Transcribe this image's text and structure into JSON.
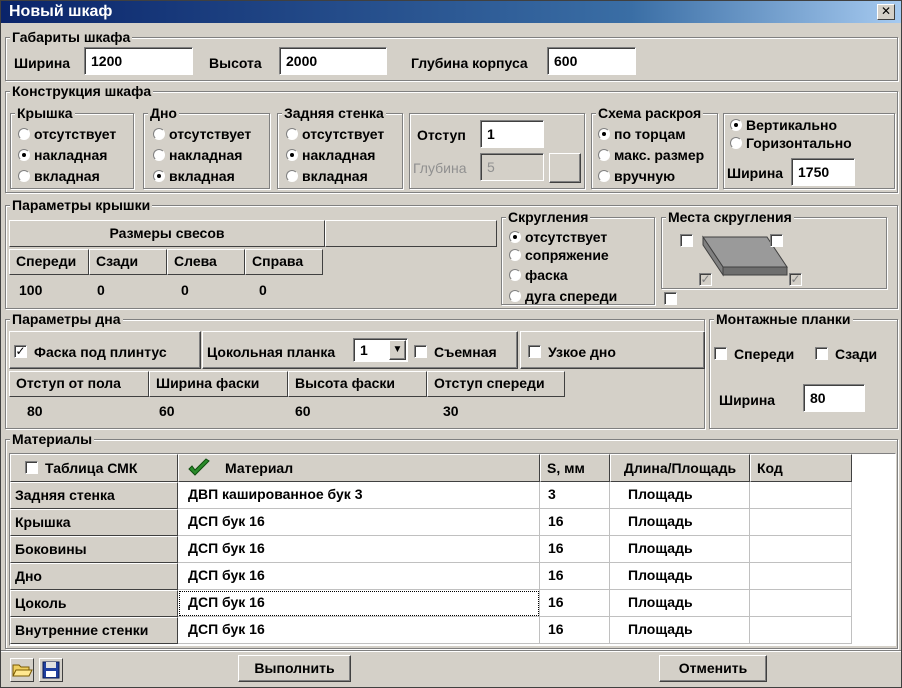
{
  "window": {
    "title": "Новый шкаф",
    "close": "✕"
  },
  "dims": {
    "legend": "Габариты шкафа",
    "width_label": "Ширина",
    "width_value": "1200",
    "height_label": "Высота",
    "height_value": "2000",
    "depth_label": "Глубина корпуса",
    "depth_value": "600"
  },
  "construction": {
    "legend": "Конструкция шкафа",
    "top": {
      "legend": "Крышка",
      "options": [
        "отсутствует",
        "накладная",
        "вкладная"
      ],
      "selected": 1
    },
    "bottom": {
      "legend": "Дно",
      "options": [
        "отсутствует",
        "накладная",
        "вкладная"
      ],
      "selected": 2
    },
    "back": {
      "legend": "Задняя стенка",
      "options": [
        "отсутствует",
        "накладная",
        "вкладная"
      ],
      "selected": 1
    },
    "offset_label": "Отступ",
    "offset_value": "1",
    "depth_label": "Глубина",
    "depth_value": "5",
    "cut": {
      "legend": "Схема раскроя",
      "options": [
        "по торцам",
        "макс. размер",
        "вручную"
      ],
      "selected": 0
    },
    "orient": {
      "options": [
        "Вертикально",
        "Горизонтально"
      ],
      "selected": 0
    },
    "orient_width_label": "Ширина",
    "orient_width_value": "1750"
  },
  "top_params": {
    "legend": "Параметры крышки",
    "overhang_header": "Размеры свесов",
    "columns": [
      "Спереди",
      "Сзади",
      "Слева",
      "Справа"
    ],
    "values": [
      "100",
      "0",
      "0",
      "0"
    ],
    "rounding": {
      "legend": "Скругления",
      "options": [
        "отсутствует",
        "сопряжение",
        "фаска",
        "дуга спереди"
      ],
      "selected": 0
    },
    "round_places": {
      "legend": "Места скругления"
    }
  },
  "bottom_params": {
    "legend": "Параметры дна",
    "chamfer_label": "Фаска под плинтус",
    "chamfer_checked": true,
    "plinth_label": "Цокольная планка",
    "plinth_value": "1",
    "dropdown_arrow": "▼",
    "removable_label": "Съемная",
    "narrow_label": "Узкое дно",
    "columns": [
      "Отступ от пола",
      "Ширина фаски",
      "Высота фаски",
      "Отступ спереди"
    ],
    "values": [
      "80",
      "60",
      "60",
      "30"
    ]
  },
  "mounting": {
    "legend": "Монтажные планки",
    "front_label": "Спереди",
    "back_label": "Сзади",
    "width_label": "Ширина",
    "width_value": "80"
  },
  "materials": {
    "legend": "Материалы",
    "cmk_label": "Таблица СМК",
    "col_material": "Материал",
    "col_s": "S, мм",
    "col_len": "Длина/Площадь",
    "col_code": "Код",
    "rows": [
      {
        "name": "Задняя стенка",
        "material": "ДВП кашированное бук 3",
        "s": "3",
        "len": "Площадь",
        "code": ""
      },
      {
        "name": "Крышка",
        "material": "ДСП бук 16",
        "s": "16",
        "len": "Площадь",
        "code": ""
      },
      {
        "name": "Боковины",
        "material": "ДСП бук 16",
        "s": "16",
        "len": "Площадь",
        "code": ""
      },
      {
        "name": "Дно",
        "material": "ДСП бук 16",
        "s": "16",
        "len": "Площадь",
        "code": ""
      },
      {
        "name": "Цоколь",
        "material": "ДСП бук 16",
        "s": "16",
        "len": "Площадь",
        "code": ""
      },
      {
        "name": "Внутренние стенки",
        "material": "ДСП бук 16",
        "s": "16",
        "len": "Площадь",
        "code": ""
      }
    ]
  },
  "footer": {
    "run_label": "Выполнить",
    "cancel_label": "Отменить"
  },
  "icons": {
    "open": "folder-open-icon",
    "save": "floppy-disk-icon",
    "check": "green-checkmark-icon"
  },
  "colors": {
    "title_start": "#0a246a",
    "title_end": "#a6caf0",
    "check_green": "#2a8a2a"
  }
}
